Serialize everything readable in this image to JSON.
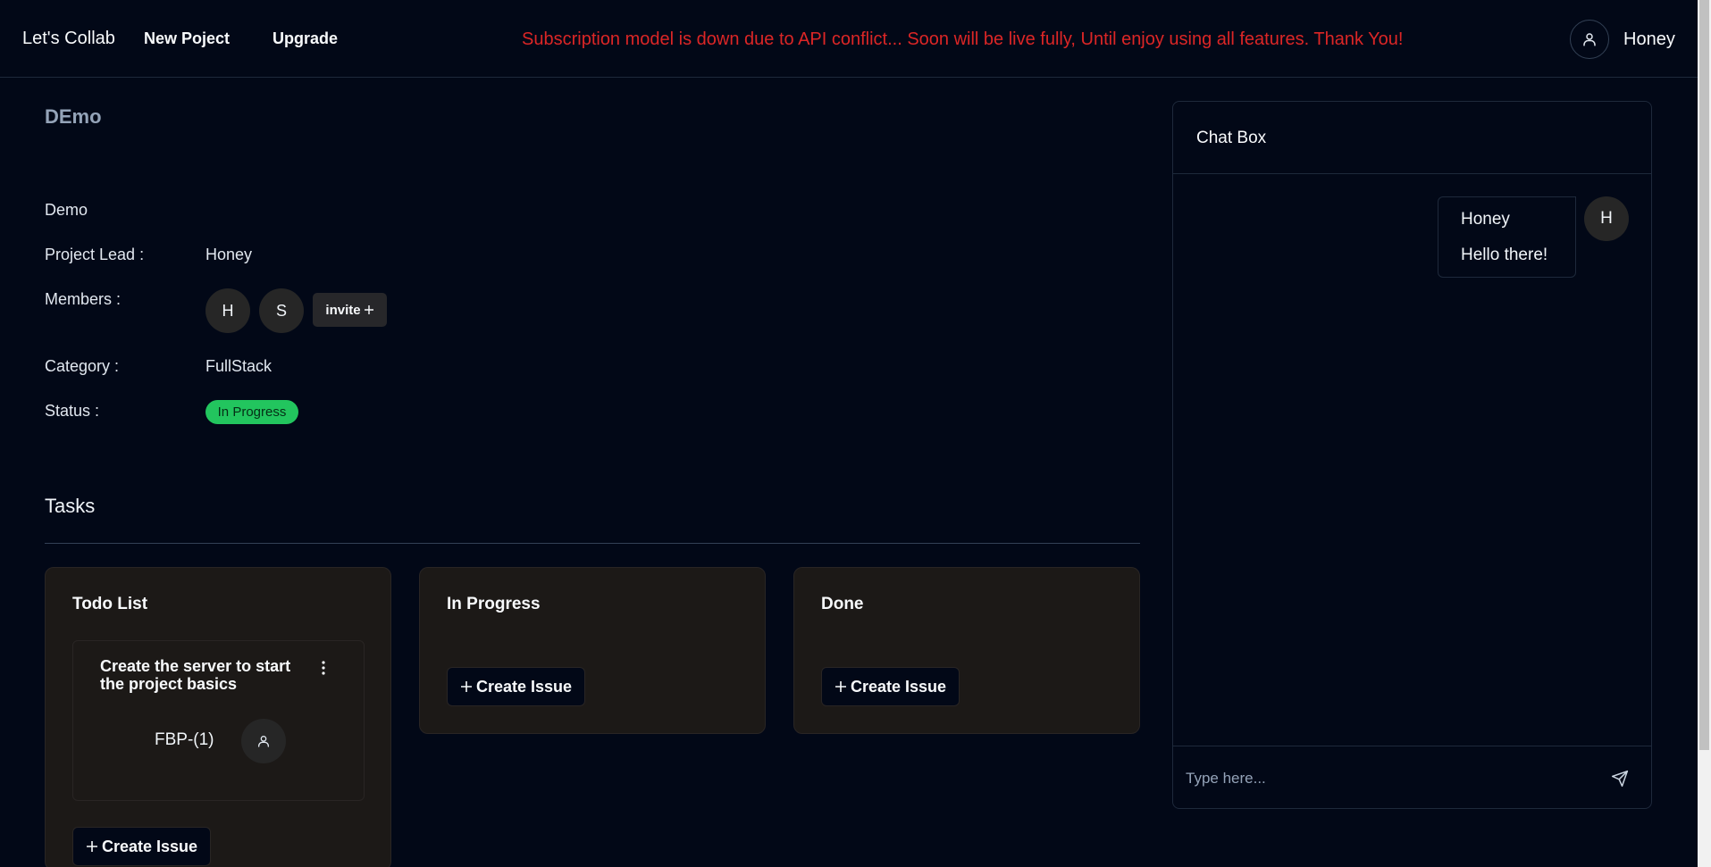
{
  "header": {
    "brand": "Let's Collab",
    "new_project": "New Poject",
    "upgrade": "Upgrade",
    "banner": "Subscription model is down due to API conflict... Soon will be live fully, Until enjoy using all features. Thank You!",
    "user_name": "Honey",
    "user_icon": "user-icon"
  },
  "project": {
    "title": "DEmo",
    "description": "Demo",
    "lead_label": "Project Lead :",
    "lead_value": "Honey",
    "members_label": "Members :",
    "members": [
      "H",
      "S"
    ],
    "invite_label": "invite",
    "category_label": "Category :",
    "category_value": "FullStack",
    "status_label": "Status :",
    "status_value": "In Progress",
    "status_color": "#22c55e"
  },
  "tasks": {
    "title": "Tasks",
    "columns": [
      {
        "title": "Todo List",
        "create_label": "Create Issue",
        "cards": [
          {
            "title": "Create the server to start the project basics",
            "key": "FBP-(1)"
          }
        ]
      },
      {
        "title": "In Progress",
        "create_label": "Create Issue",
        "cards": []
      },
      {
        "title": "Done",
        "create_label": "Create Issue",
        "cards": []
      }
    ]
  },
  "chat": {
    "title": "Chat Box",
    "messages": [
      {
        "sender": "Honey",
        "text": "Hello there!",
        "avatar": "H"
      }
    ],
    "input_placeholder": "Type here..."
  },
  "colors": {
    "background": "#020817",
    "banner_text": "#dc2626",
    "column_bg": "#1c1917"
  }
}
